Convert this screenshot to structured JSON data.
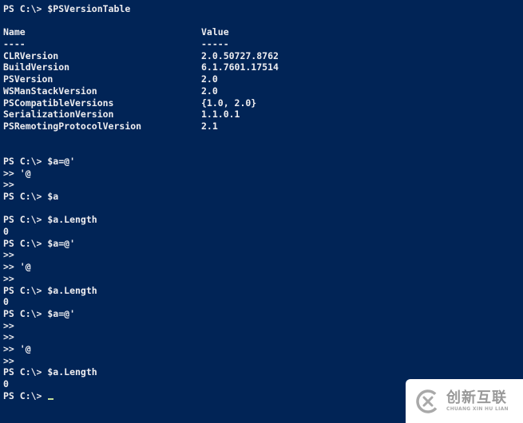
{
  "console": {
    "version_command": "PS C:\\> $PSVersionTable",
    "header": {
      "name": "Name",
      "value": "Value"
    },
    "separator": {
      "name": "----",
      "value": "-----"
    },
    "rows": [
      {
        "name": "CLRVersion",
        "value": "2.0.50727.8762"
      },
      {
        "name": "BuildVersion",
        "value": "6.1.7601.17514"
      },
      {
        "name": "PSVersion",
        "value": "2.0"
      },
      {
        "name": "WSManStackVersion",
        "value": "2.0"
      },
      {
        "name": "PSCompatibleVersions",
        "value": "{1.0, 2.0}"
      },
      {
        "name": "SerializationVersion",
        "value": "1.1.0.1"
      },
      {
        "name": "PSRemotingProtocolVersion",
        "value": "2.1"
      }
    ],
    "session": [
      "PS C:\\> $a=@'",
      ">> '@",
      ">>",
      "PS C:\\> $a",
      "",
      "PS C:\\> $a.Length",
      "0",
      "PS C:\\> $a=@'",
      ">>",
      ">> '@",
      ">>",
      "PS C:\\> $a.Length",
      "0",
      "PS C:\\> $a=@'",
      ">>",
      ">>",
      ">> '@",
      ">>",
      "PS C:\\> $a.Length",
      "0"
    ],
    "final_prompt": "PS C:\\> "
  },
  "watermark": {
    "brand_cn": "创新互联",
    "brand_en": "CHUANG XIN HU LIAN"
  },
  "colors": {
    "background": "#012456",
    "text": "#eeedf0",
    "cursor": "#c4e09a"
  }
}
